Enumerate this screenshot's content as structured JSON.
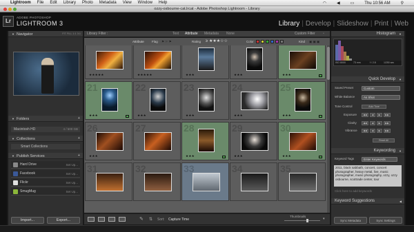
{
  "menubar": {
    "apple": "",
    "items": [
      "Lightroom",
      "File",
      "Edit",
      "Library",
      "Photo",
      "Metadata",
      "View",
      "Window",
      "Help"
    ],
    "clock": "Thu 10:56 AM"
  },
  "window": {
    "title": "ozzy-osbourne-cat.lrcat - Adobe Photoshop Lightroom - Library"
  },
  "identity": {
    "logo": "Lr",
    "line1": "ADOBE PHOTOSHOP",
    "line2": "LIGHTROOM 3"
  },
  "modules": [
    "Library",
    "Develop",
    "Slideshow",
    "Print",
    "Web"
  ],
  "modules_sep": "|",
  "left": {
    "navigator": {
      "title": "Navigator",
      "options": "FIT  FILL  1:1  3:1"
    },
    "folders": {
      "title": "Folders",
      "item": "Macintosh HD",
      "item_right": "4 / 500 GB"
    },
    "collections": {
      "title": "Collections",
      "item": "Smart Collections"
    },
    "publish": {
      "title": "Publish Services",
      "items": [
        {
          "label": "Hard Drive",
          "right": "Set Up..."
        },
        {
          "label": "Facebook",
          "right": "Set Up..."
        },
        {
          "label": "Flickr",
          "right": "Set Up..."
        },
        {
          "label": "SmugMug",
          "right": "Set Up..."
        }
      ]
    },
    "import": "Import...",
    "export": "Export..."
  },
  "filter": {
    "label": "Library Filter :",
    "tabs": [
      "Text",
      "Attribute",
      "Metadata",
      "None"
    ],
    "preset": "Custom Filter",
    "attr": {
      "label": "Attribute",
      "flag": "Flag",
      "rating": "Rating",
      "color": "Color",
      "kind": "Kind"
    }
  },
  "grid": {
    "cells": [
      {
        "num": "",
        "stars": "★★★★★",
        "bg": "#5d5d5d"
      },
      {
        "num": "",
        "stars": "★★★★★",
        "bg": "#5d5d5d"
      },
      {
        "num": "",
        "stars": "★★★",
        "bg": "#5d5d5d"
      },
      {
        "num": "",
        "stars": "★★★",
        "bg": "#5d5d5d"
      },
      {
        "num": "",
        "stars": "★★★",
        "bg": "#6a8a6a"
      },
      {
        "num": "21",
        "stars": "★★★",
        "bg": "#6a8a6a"
      },
      {
        "num": "22",
        "stars": "★★★",
        "bg": "#5d5d5d"
      },
      {
        "num": "23",
        "stars": "★★★",
        "bg": "#5d5d5d"
      },
      {
        "num": "24",
        "stars": "★★★",
        "bg": "#5d5d5d"
      },
      {
        "num": "25",
        "stars": "★★★",
        "bg": "#6a8a6a"
      },
      {
        "num": "26",
        "stars": "★★★",
        "bg": "#5d5d5d"
      },
      {
        "num": "27",
        "stars": "",
        "bg": "#5d5d5d"
      },
      {
        "num": "28",
        "stars": "★★★",
        "bg": "#6a8a6a"
      },
      {
        "num": "29",
        "stars": "★★★",
        "bg": "#5d5d5d"
      },
      {
        "num": "30",
        "stars": "★★★",
        "bg": "#6a8a6a"
      },
      {
        "num": "31",
        "stars": "",
        "bg": "#5d5d5d"
      },
      {
        "num": "32",
        "stars": "",
        "bg": "#5d5d5d"
      },
      {
        "num": "33",
        "stars": "",
        "bg": "#6a7a8a"
      },
      {
        "num": "34",
        "stars": "",
        "bg": "#5d5d5d"
      },
      {
        "num": "35",
        "stars": "",
        "bg": "#5d5d5d"
      }
    ]
  },
  "toolbar": {
    "sort_label": "Sort:",
    "sort_value": "Capture Time",
    "thumbs": "Thumbnails"
  },
  "right": {
    "histogram": {
      "title": "Histogram",
      "iso": "ISO 8000",
      "focal": "73 mm",
      "aperture": "f / 2.8",
      "shutter": "1/250 sec"
    },
    "quick_develop": {
      "title": "Quick Develop",
      "saved_preset": "Saved Preset",
      "saved_preset_value": "Custom",
      "white_balance": "White Balance",
      "white_balance_value": "As Shot",
      "tone_control": "Tone Control",
      "auto_tone": "Auto Tone",
      "exposure": "Exposure",
      "clarity": "Clarity",
      "vibrance": "Vibrance",
      "reset": "Reset All"
    },
    "keywording": {
      "title": "Keywording",
      "tags_label": "Keyword Tags",
      "tags_value": "Enter Keywords",
      "text": "2011, black sabbath, concert, concert photographer, heavy metal, live, music photographer, music photography, ozzy, ozzy osbourne, scottrade center, tour",
      "add": "Click here to add keywords"
    },
    "suggestions": {
      "title": "Keyword Suggestions"
    },
    "sync_metadata": "Sync Metadata",
    "sync_settings": "Sync Settings"
  }
}
